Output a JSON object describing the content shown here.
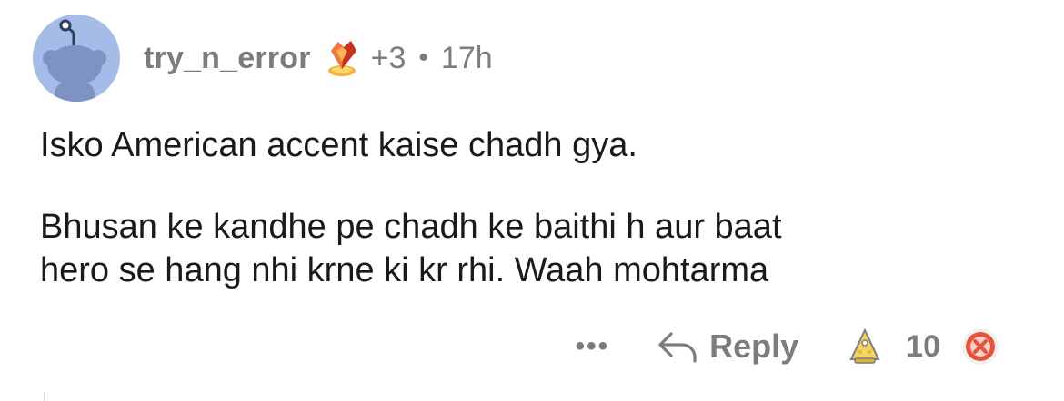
{
  "comment": {
    "username": "try_n_error",
    "award_count": "+3",
    "separator": "•",
    "time": "17h",
    "paragraphs": [
      "Isko American accent kaise chadh gya.",
      "Bhusan ke kandhe pe chadh ke baithi h aur baat\nhero se hang nhi krne ki kr rhi. Waah mohtarma"
    ]
  },
  "actions": {
    "more_label": "•••",
    "reply_label": "Reply",
    "vote_count": "10"
  },
  "icons": {
    "avatar": "reddit-snoo-avatar",
    "award": "crystal-award-icon",
    "reply": "reply-arrow-icon",
    "upvote": "cone-upvote-icon",
    "downvote": "downvote-x-icon"
  },
  "colors": {
    "avatar_bg": "#a5bbe8",
    "meta_text": "#7c7c7c",
    "body_text": "#1a1a1b",
    "downvote_accent": "#e5533b"
  }
}
